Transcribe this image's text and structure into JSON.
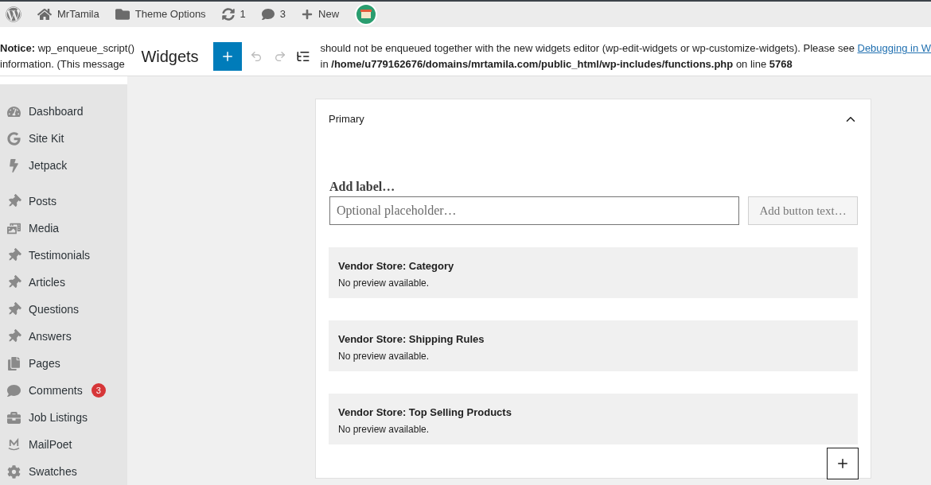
{
  "admin_bar": {
    "items": [
      {
        "kind": "logo"
      },
      {
        "kind": "home",
        "label": "MrTamila"
      },
      {
        "kind": "folder",
        "label": "Theme Options"
      },
      {
        "kind": "updates",
        "label": "1"
      },
      {
        "kind": "comments",
        "label": "3"
      },
      {
        "kind": "new",
        "label": "New"
      },
      {
        "kind": "avatar"
      }
    ]
  },
  "notice": {
    "label": "Notice:",
    "line1_start": "wp_enqueue_script()",
    "line1_end": "should not be enqueued together with the new widgets editor (wp-edit-widgets or wp-customize-widgets). Please see",
    "link": "Debugging in W",
    "line2_start": "information. (This message",
    "line2_in": "in",
    "path": "/home/u779162676/domains/mrtamila.com/public_html/wp-includes/functions.php",
    "line2_mid": "on line",
    "line_number": "5768"
  },
  "header": {
    "title": "Widgets"
  },
  "sidebar": {
    "items": [
      {
        "kind": "dashboard",
        "label": "Dashboard"
      },
      {
        "kind": "g",
        "label": "Site Kit"
      },
      {
        "kind": "bolt",
        "label": "Jetpack"
      },
      {
        "kind": "separator"
      },
      {
        "kind": "pin",
        "label": "Posts"
      },
      {
        "kind": "media",
        "label": "Media"
      },
      {
        "kind": "pin",
        "label": "Testimonials"
      },
      {
        "kind": "pin",
        "label": "Articles"
      },
      {
        "kind": "pin",
        "label": "Questions"
      },
      {
        "kind": "pin",
        "label": "Answers"
      },
      {
        "kind": "pages",
        "label": "Pages"
      },
      {
        "kind": "comment",
        "label": "Comments",
        "badge": "3"
      },
      {
        "kind": "briefcase",
        "label": "Job Listings"
      },
      {
        "kind": "m",
        "label": "MailPoet"
      },
      {
        "kind": "gear",
        "label": "Swatches"
      }
    ]
  },
  "widget_area": {
    "title": "Primary",
    "expanded": true,
    "search_block": {
      "label": "Add label…",
      "placeholder": "Optional placeholder…",
      "button": "Add button text…"
    },
    "blocks": [
      {
        "title": "Vendor Store: Category",
        "body": "No preview available."
      },
      {
        "title": "Vendor Store: Shipping Rules",
        "body": "No preview available."
      },
      {
        "title": "Vendor Store: Top Selling Products",
        "body": "No preview available."
      }
    ]
  }
}
